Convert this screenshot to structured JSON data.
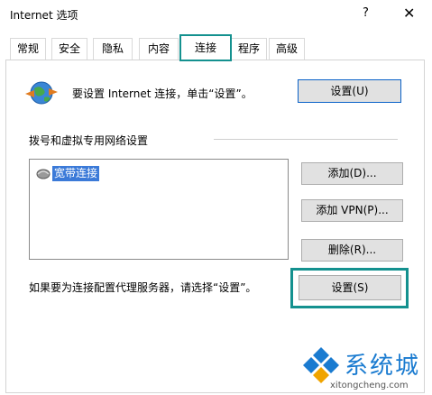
{
  "window": {
    "title": "Internet 选项",
    "help_glyph": "?",
    "close_glyph": "✕"
  },
  "tabs": [
    {
      "label": "常规"
    },
    {
      "label": "安全"
    },
    {
      "label": "隐私"
    },
    {
      "label": "内容"
    },
    {
      "label": "连接",
      "active": true
    },
    {
      "label": "程序"
    },
    {
      "label": "高级"
    }
  ],
  "setup": {
    "text": "要设置 Internet 连接，单击“设置”。",
    "button": "设置(U)"
  },
  "dialup": {
    "section_label": "拨号和虚拟专用网络设置",
    "connections": [
      "宽带连接"
    ],
    "add_button": "添加(D)...",
    "add_vpn_button": "添加 VPN(P)...",
    "delete_button": "删除(R)..."
  },
  "proxy": {
    "text": "如果要为连接配置代理服务器，请选择“设置”。",
    "button": "设置(S)"
  },
  "watermark": {
    "brand": "系统城",
    "url": "xitongcheng.com"
  },
  "colors": {
    "highlight": "#14918f",
    "selection": "#3b7ad8",
    "button_bg": "#e1e1e1",
    "watermark_blue": "#1a7bd0"
  }
}
